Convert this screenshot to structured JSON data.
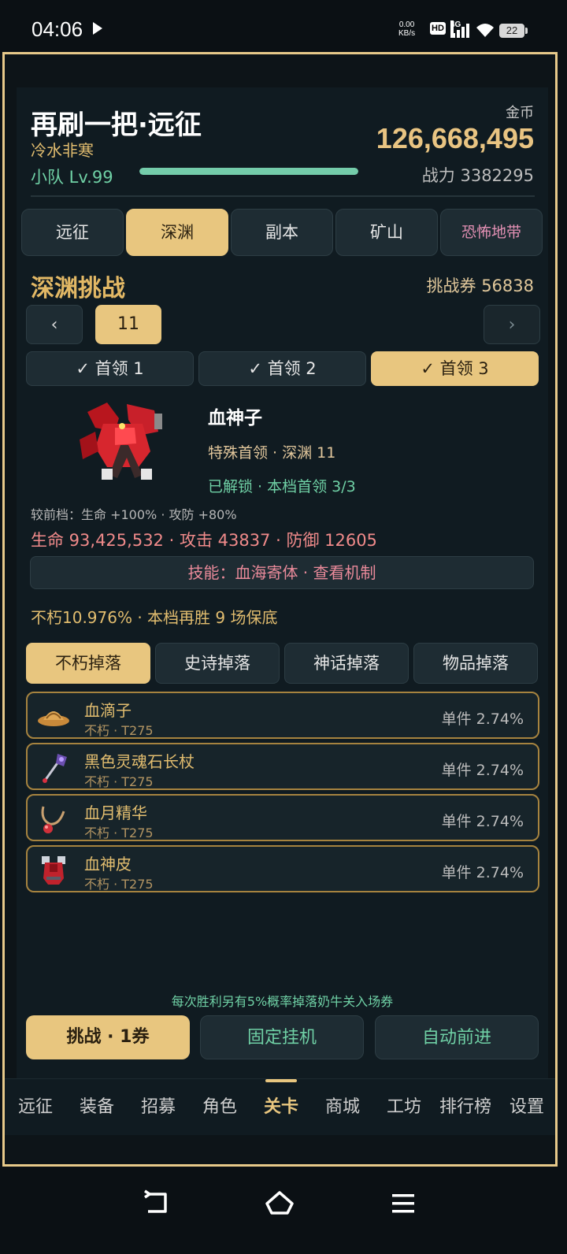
{
  "status": {
    "time": "04:06",
    "net_speed": "0.00",
    "net_unit": "KB/s",
    "hd": "HD",
    "network": "4G",
    "battery": "22"
  },
  "header": {
    "title": "再刷一把·远征",
    "subtitle": "冷水非寒",
    "team_level": "小队 Lv.99",
    "level_progress": 1.0,
    "gold_label": "金币",
    "gold_value": "126,668,495",
    "power": "战力 3382295"
  },
  "mode_tabs": [
    "远征",
    "深渊",
    "副本",
    "矿山",
    "恐怖地带"
  ],
  "active_mode": "深渊",
  "abyss": {
    "title": "深渊挑战",
    "tickets": "挑战券 56838",
    "prev": "‹",
    "level": "11",
    "next": "›"
  },
  "boss_tabs": [
    "✓ 首领 1",
    "✓ 首领 2",
    "✓ 首领 3"
  ],
  "boss": {
    "name": "血神子",
    "type": "特殊首领 · 深渊 11",
    "unlock": "已解锁 · 本档首领 3/3",
    "compare": "较前档：生命 +100% · 攻防 +80%",
    "stats": "生命 93,425,532 · 攻击 43837 · 防御 12605",
    "skill": "技能：血海寄体 · 查看机制",
    "pity": "不朽10.976% · 本档再胜 9 场保底"
  },
  "drop_tabs": [
    "不朽掉落",
    "史诗掉落",
    "神话掉落",
    "物品掉落"
  ],
  "drops": [
    {
      "icon": "hat-icon",
      "name": "血滴子",
      "sub": "不朽 · T275",
      "rate": "单件 2.74%"
    },
    {
      "icon": "staff-icon",
      "name": "黑色灵魂石长杖",
      "sub": "不朽 · T275",
      "rate": "单件 2.74%"
    },
    {
      "icon": "necklace-icon",
      "name": "血月精华",
      "sub": "不朽 · T275",
      "rate": "单件 2.74%"
    },
    {
      "icon": "armor-icon",
      "name": "血神皮",
      "sub": "不朽 · T275",
      "rate": "单件 2.74%"
    }
  ],
  "note": "每次胜利另有5%概率掉落奶牛关入场券",
  "actions": {
    "challenge": "挑战 · 1券",
    "idle": "固定挂机",
    "auto": "自动前进"
  },
  "bottom_nav": [
    "远征",
    "装备",
    "招募",
    "角色",
    "关卡",
    "商城",
    "工坊",
    "排行榜",
    "设置"
  ],
  "active_nav": "关卡",
  "colors": {
    "accent": "#e8c67f",
    "green": "#6fd0a5",
    "panel": "#101b21",
    "frame": "#e7c98a"
  }
}
